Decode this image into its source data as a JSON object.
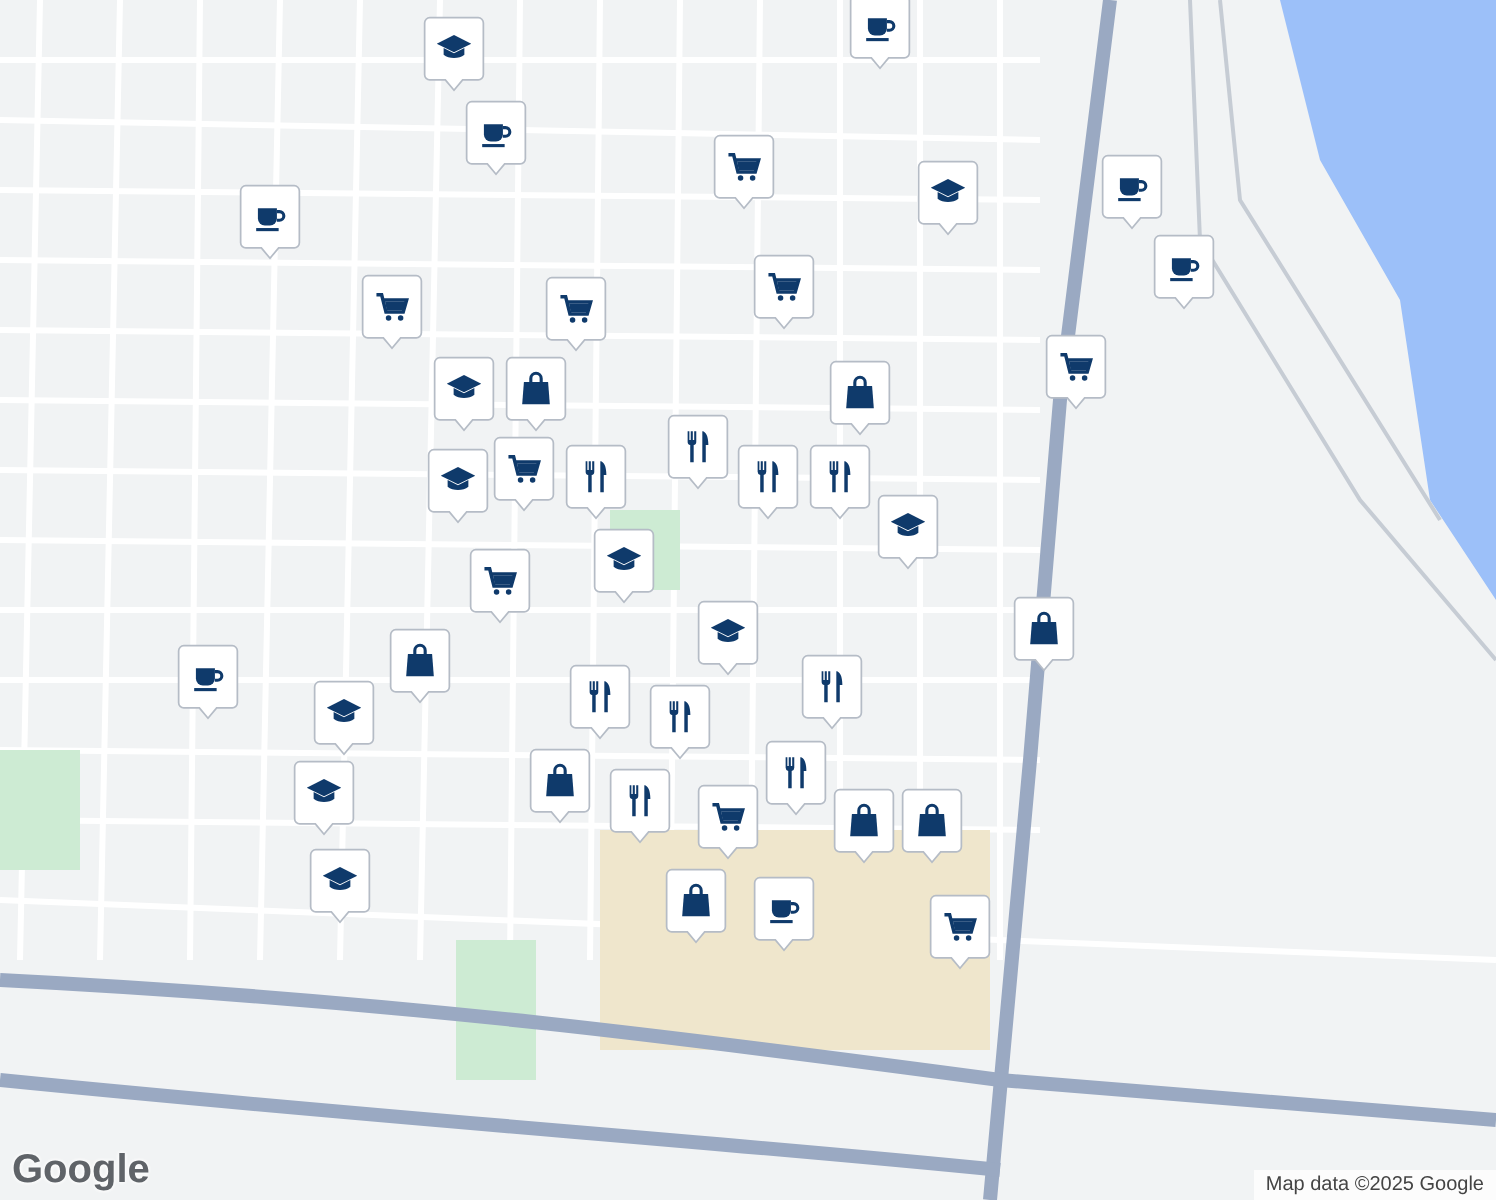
{
  "map": {
    "markers": [
      {
        "kind": "school"
      },
      {
        "kind": "coffee"
      },
      {
        "kind": "coffee"
      },
      {
        "kind": "cart"
      },
      {
        "kind": "school"
      },
      {
        "kind": "coffee"
      },
      {
        "kind": "coffee"
      },
      {
        "kind": "coffee"
      },
      {
        "kind": "cart"
      },
      {
        "kind": "cart"
      },
      {
        "kind": "cart"
      },
      {
        "kind": "bag"
      },
      {
        "kind": "school"
      },
      {
        "kind": "cart"
      },
      {
        "kind": "cart"
      },
      {
        "kind": "food"
      },
      {
        "kind": "bag"
      },
      {
        "kind": "food"
      },
      {
        "kind": "food"
      },
      {
        "kind": "school"
      },
      {
        "kind": "food"
      },
      {
        "kind": "school"
      },
      {
        "kind": "school"
      },
      {
        "kind": "cart"
      },
      {
        "kind": "bag"
      },
      {
        "kind": "school"
      },
      {
        "kind": "bag"
      },
      {
        "kind": "coffee"
      },
      {
        "kind": "food"
      },
      {
        "kind": "school"
      },
      {
        "kind": "food"
      },
      {
        "kind": "bag"
      },
      {
        "kind": "food"
      },
      {
        "kind": "food"
      },
      {
        "kind": "food"
      },
      {
        "kind": "school"
      },
      {
        "kind": "cart"
      },
      {
        "kind": "bag"
      },
      {
        "kind": "bag"
      },
      {
        "kind": "school"
      },
      {
        "kind": "bag"
      },
      {
        "kind": "coffee"
      },
      {
        "kind": "cart"
      }
    ]
  },
  "logo": "Google",
  "attribution": "Map data ©2025 Google"
}
